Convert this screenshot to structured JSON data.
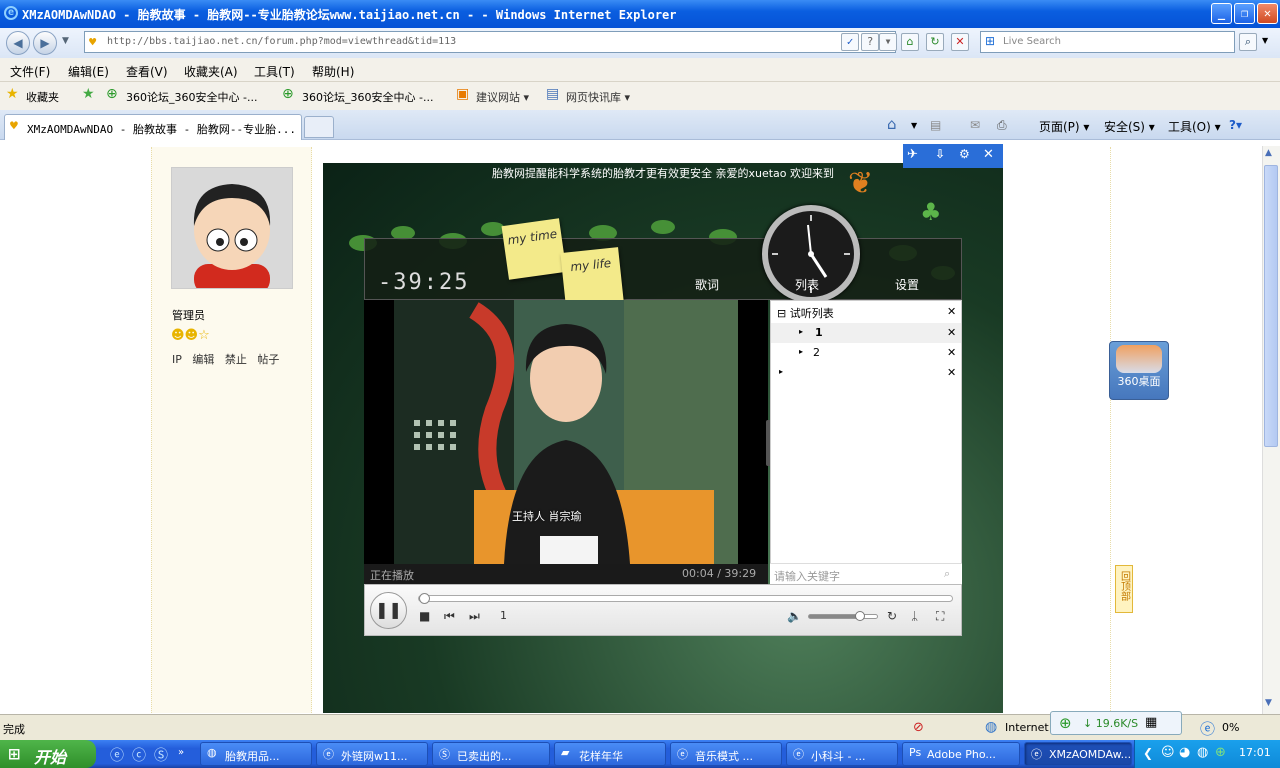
{
  "window": {
    "title": "XMzAOMDAwNDAO - 胎教故事 - 胎教网--专业胎教论坛www.taijiao.net.cn - - Windows Internet Explorer",
    "min": "_",
    "max": "❐",
    "close": "✕"
  },
  "address": {
    "url": "http://bbs.taijiao.net.cn/forum.php?mod=viewthread&tid=113",
    "search_placeholder": "Live Search"
  },
  "menu": [
    "文件(F)",
    "编辑(E)",
    "查看(V)",
    "收藏夹(A)",
    "工具(T)",
    "帮助(H)"
  ],
  "favorites": {
    "label": "收藏夹",
    "items": [
      "360论坛_360安全中心 -...",
      "360论坛_360安全中心 -...",
      "建议网站 ▾",
      "网页快讯库 ▾"
    ]
  },
  "tabs": {
    "active": "XMzAOMDAwNDAO - 胎教故事 - 胎教网--专业胎...",
    "tools": [
      "页面(P) ▾",
      "安全(S) ▾",
      "工具(O) ▾"
    ]
  },
  "profile": {
    "role": "管理员",
    "links": [
      "IP",
      "编辑",
      "禁止",
      "帖子"
    ]
  },
  "player": {
    "notice": "胎教网提醒能科学系统的胎教才更有效更安全 亲爱的xuetao 欢迎来到",
    "timer": "-39:25",
    "note1": "my time",
    "note2": "my life",
    "nav": [
      "歌词",
      "列表",
      "设置"
    ],
    "status": "正在播放",
    "time": "00:04 / 39:29",
    "caption": "王持人 肖宗瑜",
    "playlist_title": "试听列表",
    "playlist_items": [
      "1",
      "2",
      ""
    ],
    "search_placeholder": "请输入关键字",
    "track": "1"
  },
  "side": {
    "desk360": "360桌面",
    "backtop": "回顶部"
  },
  "statusbar": {
    "text": "完成",
    "zone": "Internet",
    "speed": "19.6K/S",
    "zoom": "0%"
  },
  "taskbar": {
    "start": "开始",
    "tasks": [
      "胎教用品...",
      "外链网w11...",
      "已卖出的...",
      "花样年华",
      "音乐模式 ...",
      "小科斗 - ...",
      "Adobe Pho...",
      "XMzAOMDAw..."
    ],
    "clock": "17:01"
  },
  "colors": {
    "title_blue": "#0653d6",
    "taskbar_blue": "#245edb",
    "start_green": "#3f9d3a"
  }
}
